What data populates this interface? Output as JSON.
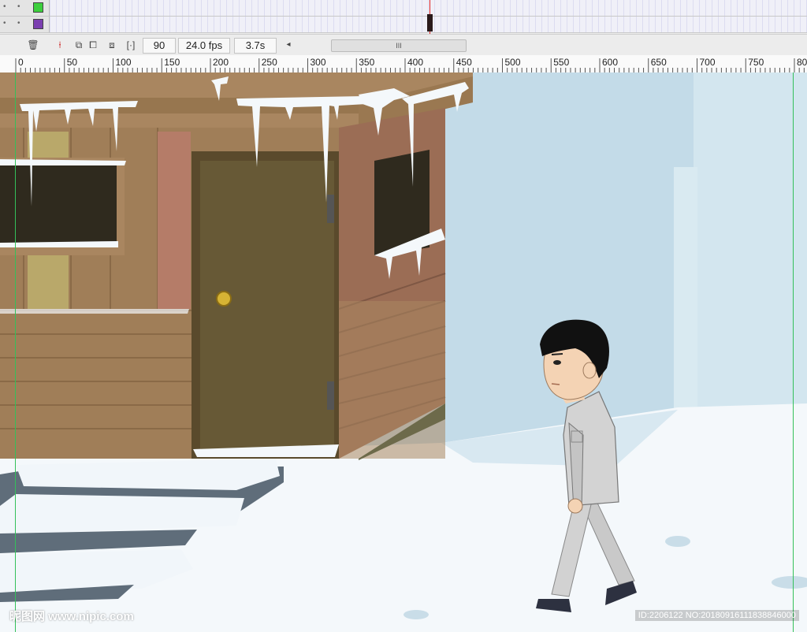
{
  "timeline": {
    "layers": [
      {
        "color": "#3ccf3c"
      },
      {
        "color": "#7b3fb0"
      }
    ],
    "current_frame": "90",
    "fps": "24.0 fps",
    "time": "3.7s",
    "scroll_label": "III"
  },
  "ruler": {
    "ticks": [
      "0",
      "50",
      "100",
      "150",
      "200",
      "250",
      "300",
      "350",
      "400",
      "450",
      "500",
      "550",
      "600",
      "650",
      "700",
      "750",
      "80"
    ]
  },
  "icons": {
    "trash": "trash-icon",
    "onion_skin": "onion-skin-icon",
    "onion_outline": "onion-skin-outline-icon",
    "edit_multiple": "edit-multiple-frames-icon",
    "modify_markers": "modify-onion-markers-icon",
    "center_frame": "center-frame-icon"
  },
  "watermark": {
    "left": "昵图网 www.nipic.com",
    "right": "ID:2206122 NO:20180916111838846000"
  },
  "colors": {
    "sky": "#c3dbe8",
    "snow": "#f4f8fb",
    "wood": "#a07e58",
    "door": "#675936",
    "guide": "#34c05a"
  }
}
